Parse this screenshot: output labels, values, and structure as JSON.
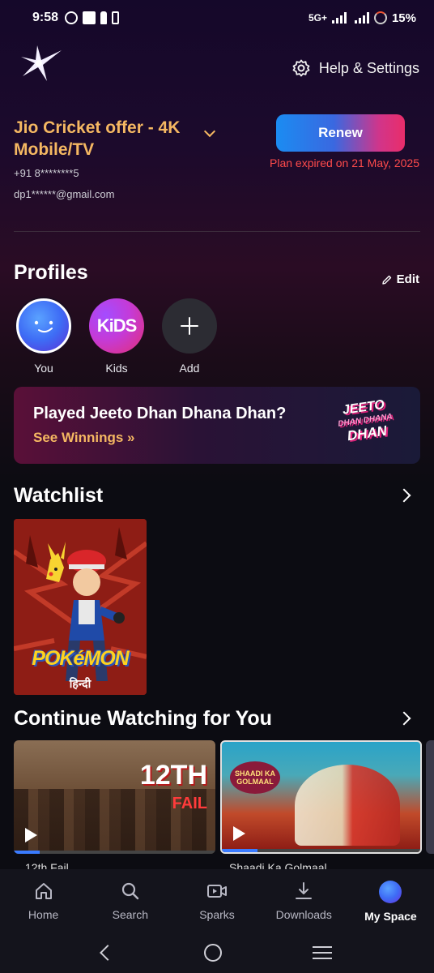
{
  "status_bar": {
    "time": "9:58",
    "network": "5G+",
    "battery": "15%"
  },
  "header": {
    "help_label": "Help & Settings"
  },
  "plan": {
    "title": "Jio Cricket offer - 4K Mobile/TV",
    "phone": "+91 8********5",
    "email": "dp1******@gmail.com",
    "renew_label": "Renew",
    "expired_text": "Plan expired on 21 May, 2025"
  },
  "profiles": {
    "title": "Profiles",
    "edit_label": "Edit",
    "items": [
      {
        "label": "You"
      },
      {
        "label": "Kids",
        "avatar_text": "KiDS"
      },
      {
        "label": "Add"
      }
    ]
  },
  "banner": {
    "title": "Played Jeeto Dhan Dhana Dhan?",
    "link": "See Winnings »",
    "logo_lines": [
      "JEETO",
      "DHAN DHANA",
      "DHAN"
    ]
  },
  "watchlist": {
    "title": "Watchlist",
    "items": [
      {
        "brand": "POKéMON",
        "language": "हिन्दी"
      }
    ]
  },
  "continue_watching": {
    "title": "Continue Watching for You",
    "items": [
      {
        "title": "12th Fail",
        "art_text": "12TH",
        "art_sub": "FAIL",
        "progress": 0.13
      },
      {
        "title": "Shaadi Ka Golmaal",
        "art_text": "SHAADI KA GOLMAAL",
        "progress": 0.18
      }
    ]
  },
  "bottom_nav": {
    "items": [
      {
        "label": "Home",
        "icon": "home-icon"
      },
      {
        "label": "Search",
        "icon": "search-icon"
      },
      {
        "label": "Sparks",
        "icon": "video-icon"
      },
      {
        "label": "Downloads",
        "icon": "download-icon"
      },
      {
        "label": "My Space",
        "icon": "avatar",
        "active": true
      }
    ]
  },
  "colors": {
    "accent_gold": "#f5b862",
    "error_red": "#ff4b4b",
    "background": "#0c0c12"
  }
}
